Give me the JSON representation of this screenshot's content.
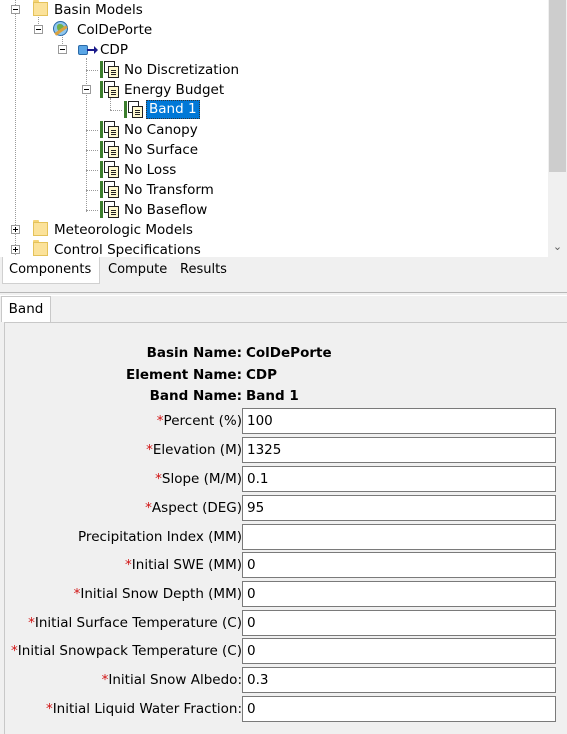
{
  "tree": {
    "basin_models": "Basin Models",
    "basin": "ColDePorte",
    "element": "CDP",
    "methods": [
      "No Discretization",
      "Energy Budget",
      "No Canopy",
      "No Surface",
      "No Loss",
      "No Transform",
      "No Baseflow"
    ],
    "band": "Band 1",
    "meteorologic_models": "Meteorologic Models",
    "control_specifications": "Control Specifications"
  },
  "tabs": {
    "components": "Components",
    "compute": "Compute",
    "results": "Results"
  },
  "panel": {
    "tab": "Band"
  },
  "info": {
    "basin_name_label": "Basin Name:",
    "basin_name_value": "ColDePorte",
    "element_name_label": "Element Name:",
    "element_name_value": "CDP",
    "band_name_label": "Band Name:",
    "band_name_value": "Band 1"
  },
  "fields": [
    {
      "label": "Percent (%)",
      "required": "*",
      "value": "100"
    },
    {
      "label": "Elevation (M)",
      "required": "*",
      "value": "1325"
    },
    {
      "label": "Slope (M/M)",
      "required": "*",
      "value": "0.1"
    },
    {
      "label": "Aspect (DEG)",
      "required": "*",
      "value": "95"
    },
    {
      "label": "Precipitation Index (MM)",
      "required": "",
      "value": ""
    },
    {
      "label": "Initial SWE (MM)",
      "required": "*",
      "value": "0"
    },
    {
      "label": "Initial Snow Depth (MM)",
      "required": "*",
      "value": "0"
    },
    {
      "label": "Initial Surface Temperature (C)",
      "required": "*",
      "value": "0"
    },
    {
      "label": "Initial Snowpack Temperature (C)",
      "required": "*",
      "value": "0"
    },
    {
      "label": "Initial Snow Albedo:",
      "required": "*",
      "value": "0.3"
    },
    {
      "label": "Initial Liquid Water Fraction:",
      "required": "*",
      "value": "0"
    }
  ],
  "colors": {
    "selection": "#0078d7",
    "required_mark": "#d01010"
  }
}
